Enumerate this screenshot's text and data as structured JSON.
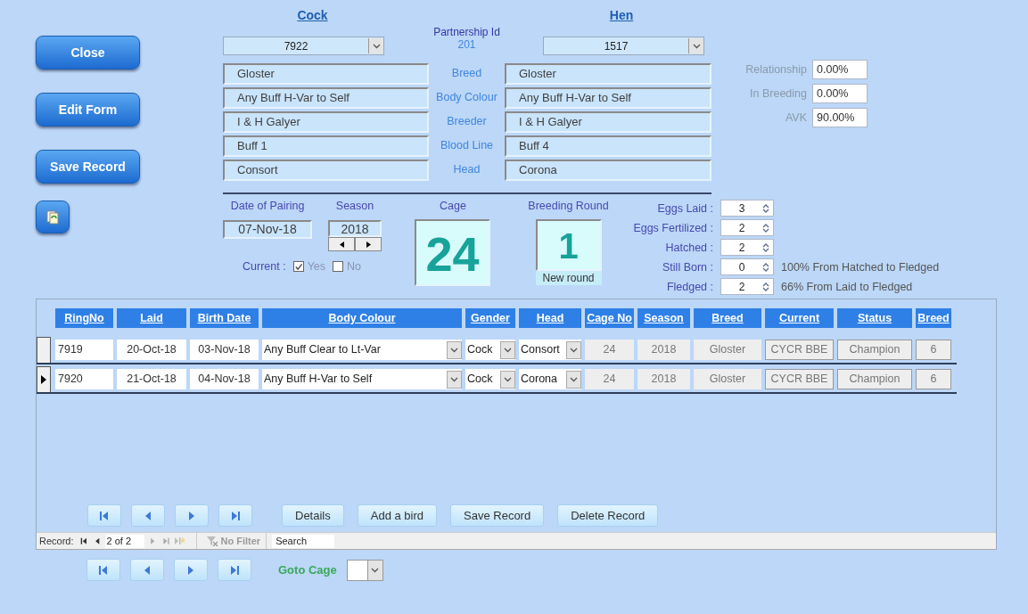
{
  "buttons": [
    {
      "label": "Close"
    },
    {
      "label": "Edit Form"
    },
    {
      "label": "Save Record"
    }
  ],
  "cock": {
    "heading": "Cock",
    "ring": "7922",
    "fields": [
      "Gloster",
      "Any Buff H-Var to Self",
      "I & H Galyer",
      "Buff 1",
      "Consort"
    ]
  },
  "partnership": {
    "label": "Partnership Id",
    "value": "201"
  },
  "field_labels": [
    "Breed",
    "Body Colour",
    "Breeder",
    "Blood Line",
    "Head"
  ],
  "hen": {
    "heading": "Hen",
    "ring": "1517",
    "fields": [
      "Gloster",
      "Any Buff H-Var to Self",
      "I & H Galyer",
      "Buff 4",
      "Corona"
    ]
  },
  "stats": [
    {
      "label": "Relationship",
      "value": "0.00%"
    },
    {
      "label": "In Breeding",
      "value": "0.00%"
    },
    {
      "label": "AVK",
      "value": "90.00%"
    }
  ],
  "pairing": {
    "date_label": "Date of Pairing",
    "date": "07-Nov-18",
    "season_label": "Season",
    "season": "2018",
    "current_label": "Current :",
    "options": [
      {
        "label": "Yes",
        "checked": true
      },
      {
        "label": "No",
        "checked": false
      }
    ]
  },
  "cage": {
    "label": "Cage",
    "value": "24"
  },
  "round": {
    "label": "Breeding Round",
    "value": "1",
    "button": "New round"
  },
  "counts": [
    {
      "label": "Eggs Laid :",
      "value": "3"
    },
    {
      "label": "Eggs Fertilized :",
      "value": "2"
    },
    {
      "label": "Hatched :",
      "value": "2"
    },
    {
      "label": "Still Born :",
      "value": "0",
      "note": "100% From Hatched to Fledged"
    },
    {
      "label": "Fledged :",
      "value": "2",
      "note": "66% From Laid to Fledged"
    }
  ],
  "table": {
    "columns": [
      {
        "label": "RingNo",
        "kind": "text"
      },
      {
        "label": "Laid",
        "kind": "date"
      },
      {
        "label": "Birth Date",
        "kind": "date"
      },
      {
        "label": "Body Colour",
        "kind": "combo"
      },
      {
        "label": "Gender",
        "kind": "combo"
      },
      {
        "label": "Head",
        "kind": "combo"
      },
      {
        "label": "Cage No",
        "kind": "locked"
      },
      {
        "label": "Season",
        "kind": "locked"
      },
      {
        "label": "Breed",
        "kind": "locked"
      },
      {
        "label": "Current",
        "kind": "boxed"
      },
      {
        "label": "Status",
        "kind": "boxed"
      },
      {
        "label": "Breed",
        "kind": "boxed"
      }
    ],
    "rows": [
      {
        "selected": false,
        "cells": [
          "7919",
          "20-Oct-18",
          "03-Nov-18",
          "Any Buff Clear to Lt-Var",
          "Cock",
          "Consort",
          "24",
          "2018",
          "Gloster",
          "CYCR BBE",
          "Champion",
          "6"
        ]
      },
      {
        "selected": true,
        "cells": [
          "7920",
          "21-Oct-18",
          "04-Nov-18",
          "Any Buff H-Var to Self",
          "Cock",
          "Corona",
          "24",
          "2018",
          "Gloster",
          "CYCR BBE",
          "Champion",
          "6"
        ]
      }
    ]
  },
  "subform_buttons": [
    "Details",
    "Add a bird",
    "Save Record",
    "Delete Record"
  ],
  "record_nav": {
    "label": "Record:",
    "position": "2 of 2",
    "filter": "No Filter",
    "search": "Search"
  },
  "goto_cage": {
    "label": "Goto Cage"
  }
}
